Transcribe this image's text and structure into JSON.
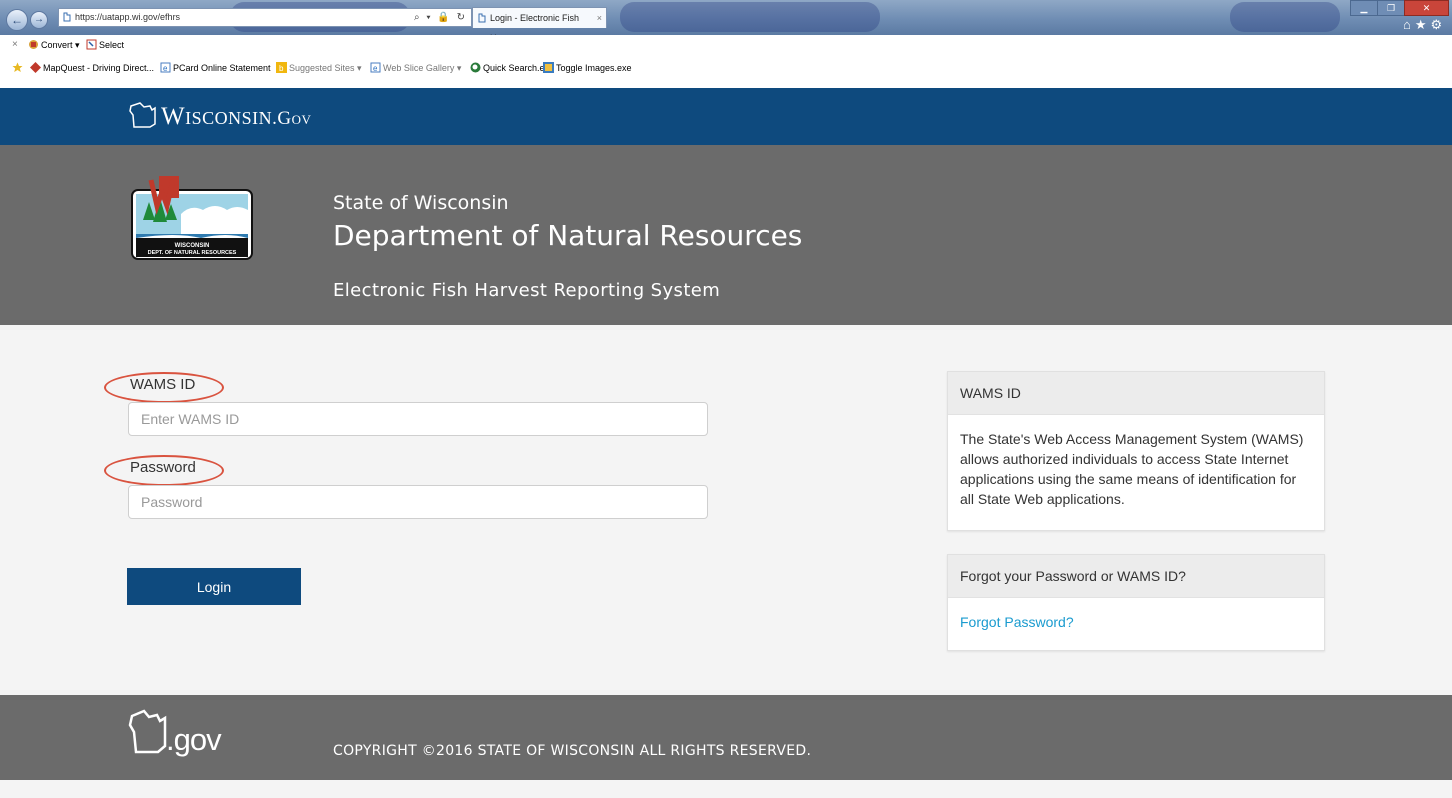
{
  "browser": {
    "url": "https://uatapp.wi.gov/efhrs",
    "address_controls": "⌕ ▾ 🔒 ↻",
    "tab_title": "Login - Electronic Fish Harv...",
    "tab_close": "×",
    "command_bar": {
      "convert": "Convert",
      "select": "Select"
    },
    "favorites": [
      "MapQuest - Driving Direct...",
      "PCard Online Statement",
      "Suggested Sites ▾",
      "Web Slice Gallery ▾",
      "Quick Search.exe",
      "Toggle Images.exe"
    ]
  },
  "banner": {
    "brand": "Wisconsin",
    "brand_suffix": ".Gov"
  },
  "hero": {
    "state": "State of Wisconsin",
    "department": "Department of Natural Resources",
    "system": "Electronic Fish Harvest Reporting System",
    "logo_text_1": "WISCONSIN",
    "logo_text_2": "DEPT. OF NATURAL RESOURCES"
  },
  "form": {
    "wams_label": "WAMS ID",
    "wams_placeholder": "Enter WAMS ID",
    "password_label": "Password",
    "password_placeholder": "Password",
    "login_label": "Login"
  },
  "info_panel": {
    "title": "WAMS ID",
    "body": "The State's Web Access Management System (WAMS) allows authorized individuals to access State Internet applications using the same means of identification for all State Web applications."
  },
  "forgot_panel": {
    "title": "Forgot your Password or WAMS ID?",
    "link": "Forgot Password?"
  },
  "footer": {
    "gov": ".gov",
    "copyright": "COPYRIGHT ©2016 STATE OF WISCONSIN ALL RIGHTS RESERVED."
  },
  "colors": {
    "banner": "#0e4a7e",
    "hero": "#6b6b6b",
    "annotation": "#d9533f",
    "link": "#1a9bcf"
  }
}
